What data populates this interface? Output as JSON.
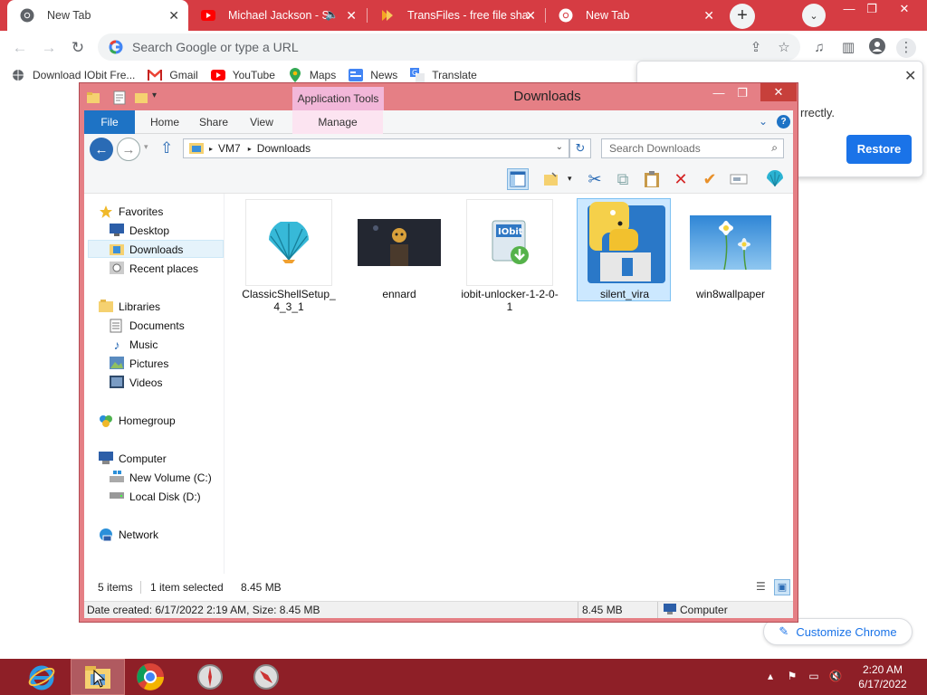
{
  "chrome": {
    "tabs": [
      {
        "title": "New Tab",
        "icon": "chrome-icon",
        "active": true
      },
      {
        "title": "Michael Jackson - Sn",
        "icon": "youtube-icon",
        "audio": true
      },
      {
        "title": "TransFiles - free file shari",
        "icon": "transfiles-icon"
      },
      {
        "title": "New Tab",
        "icon": "chrome-icon"
      }
    ],
    "new_tab": "+",
    "omnibox_placeholder": "Search Google or type a URL",
    "bookmarks": [
      {
        "label": "Download IObit Fre...",
        "icon": "globe-icon"
      },
      {
        "label": "Gmail",
        "icon": "gmail-icon"
      },
      {
        "label": "YouTube",
        "icon": "youtube-icon"
      },
      {
        "label": "Maps",
        "icon": "maps-icon"
      },
      {
        "label": "News",
        "icon": "news-icon"
      },
      {
        "label": "Translate",
        "icon": "translate-icon"
      }
    ],
    "restore_popup": {
      "text": "rrectly.",
      "button": "Restore"
    },
    "customize_button": "Customize Chrome"
  },
  "explorer": {
    "title": "Downloads",
    "app_tools": "Application Tools",
    "ribbon_tabs": [
      "File",
      "Home",
      "Share",
      "View",
      "Manage"
    ],
    "path": [
      "VM7",
      "Downloads"
    ],
    "search_placeholder": "Search Downloads",
    "nav": {
      "favorites": "Favorites",
      "favorites_items": [
        "Desktop",
        "Downloads",
        "Recent places"
      ],
      "libraries": "Libraries",
      "libraries_items": [
        "Documents",
        "Music",
        "Pictures",
        "Videos"
      ],
      "homegroup": "Homegroup",
      "computer": "Computer",
      "computer_items": [
        "New Volume (C:)",
        "Local Disk (D:)"
      ],
      "network": "Network"
    },
    "files": [
      {
        "name": "ClassicShellSetup_4_3_1",
        "icon": "classic-shell-icon"
      },
      {
        "name": "ennard",
        "icon": "image-thumbnail"
      },
      {
        "name": "iobit-unlocker-1-2-0-1",
        "icon": "iobit-installer-icon"
      },
      {
        "name": "silent_vira",
        "icon": "python-file-icon",
        "selected": true
      },
      {
        "name": "win8wallpaper",
        "icon": "image-thumbnail"
      }
    ],
    "status": {
      "items": "5 items",
      "selected": "1 item selected",
      "size": "8.45 MB"
    },
    "details": {
      "info": "Date created: 6/17/2022 2:19 AM, Size: 8.45 MB",
      "size": "8.45 MB",
      "location": "Computer"
    }
  },
  "taskbar": {
    "time": "2:20 AM",
    "date": "6/17/2022"
  },
  "colors": {
    "chrome_frame": "#d63c43",
    "explorer_frame": "#e57f85",
    "taskbar": "#8e1f27",
    "accent_blue": "#1a73e8"
  }
}
